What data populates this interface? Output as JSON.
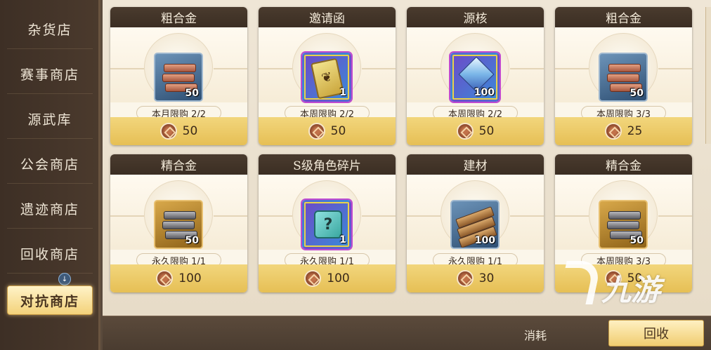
{
  "sidebar": {
    "items": [
      {
        "label": "杂货店"
      },
      {
        "label": "赛事商店"
      },
      {
        "label": "源武库"
      },
      {
        "label": "公会商店"
      },
      {
        "label": "遗迹商店"
      },
      {
        "label": "回收商店"
      },
      {
        "label": "对抗商店",
        "active": true
      }
    ],
    "badge": "↓"
  },
  "cards": [
    {
      "title": "粗合金",
      "qty": "50",
      "limit": "本月限购 2/2",
      "price": "50",
      "icon": "copper-ingot-icon"
    },
    {
      "title": "邀请函",
      "qty": "1",
      "limit": "本周限购 2/2",
      "price": "50",
      "icon": "ticket-icon"
    },
    {
      "title": "源核",
      "qty": "100",
      "limit": "本周限购 2/2",
      "price": "50",
      "icon": "crystal-icon"
    },
    {
      "title": "粗合金",
      "qty": "50",
      "limit": "本周限购 3/3",
      "price": "25",
      "icon": "copper-ingot-icon"
    },
    {
      "title": "精合金",
      "qty": "50",
      "limit": "永久限购 1/1",
      "price": "100",
      "icon": "steel-ingot-icon"
    },
    {
      "title": "S级角色碎片",
      "qty": "1",
      "limit": "永久限购 1/1",
      "price": "100",
      "icon": "puzzle-icon"
    },
    {
      "title": "建材",
      "qty": "100",
      "limit": "永久限购 1/1",
      "price": "30",
      "icon": "planks-icon"
    },
    {
      "title": "精合金",
      "qty": "50",
      "limit": "本周限购 3/3",
      "price": "50",
      "icon": "steel-ingot-icon"
    }
  ],
  "bottombar": {
    "consume_label": "消耗",
    "reclaim_label": "回收"
  },
  "watermark": "九游",
  "colors": {
    "sidebar_bg": "#3d2f25",
    "card_header": "#4a3b2e",
    "price_bar": "#f2d67c",
    "active_tab": "#f3d27a"
  }
}
